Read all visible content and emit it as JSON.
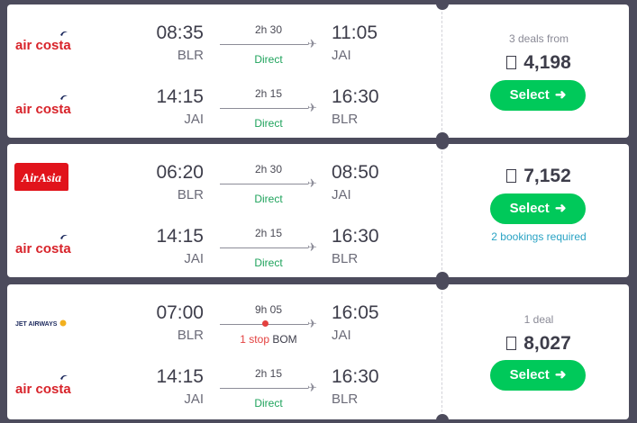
{
  "results": [
    {
      "legs": [
        {
          "airline": "air costa",
          "logo": "air-costa-logo",
          "dep_time": "08:35",
          "dep_code": "BLR",
          "duration": "2h 30",
          "stops": "Direct",
          "arr_time": "11:05",
          "arr_code": "JAI"
        },
        {
          "airline": "air costa",
          "logo": "air-costa-logo",
          "dep_time": "14:15",
          "dep_code": "JAI",
          "duration": "2h 15",
          "stops": "Direct",
          "arr_time": "16:30",
          "arr_code": "BLR"
        }
      ],
      "deals": "3 deals from",
      "price": "4,198",
      "select_label": "Select"
    },
    {
      "legs": [
        {
          "airline": "AirAsia",
          "logo": "airasia-logo",
          "dep_time": "06:20",
          "dep_code": "BLR",
          "duration": "2h 30",
          "stops": "Direct",
          "arr_time": "08:50",
          "arr_code": "JAI"
        },
        {
          "airline": "air costa",
          "logo": "air-costa-logo",
          "dep_time": "14:15",
          "dep_code": "JAI",
          "duration": "2h 15",
          "stops": "Direct",
          "arr_time": "16:30",
          "arr_code": "BLR"
        }
      ],
      "price": "7,152",
      "select_label": "Select",
      "bookings": "2 bookings required"
    },
    {
      "legs": [
        {
          "airline": "JET AIRWAYS",
          "logo": "jet-airways-logo",
          "dep_time": "07:00",
          "dep_code": "BLR",
          "duration": "9h 05",
          "stops": "1 stop",
          "via": "BOM",
          "arr_time": "16:05",
          "arr_code": "JAI"
        },
        {
          "airline": "air costa",
          "logo": "air-costa-logo",
          "dep_time": "14:15",
          "dep_code": "JAI",
          "duration": "2h 15",
          "stops": "Direct",
          "arr_time": "16:30",
          "arr_code": "BLR"
        }
      ],
      "deals": "1 deal",
      "price": "8,027",
      "select_label": "Select"
    }
  ],
  "colors": {
    "background": "#4c4b5c",
    "select_button": "#00c95a",
    "direct": "#1fa35c",
    "one_stop": "#e3403f",
    "bookings_link": "#2aa3c4",
    "air_costa_red": "#d8232a",
    "air_costa_navy": "#1d2a5e",
    "airasia_red": "#e1131b"
  }
}
